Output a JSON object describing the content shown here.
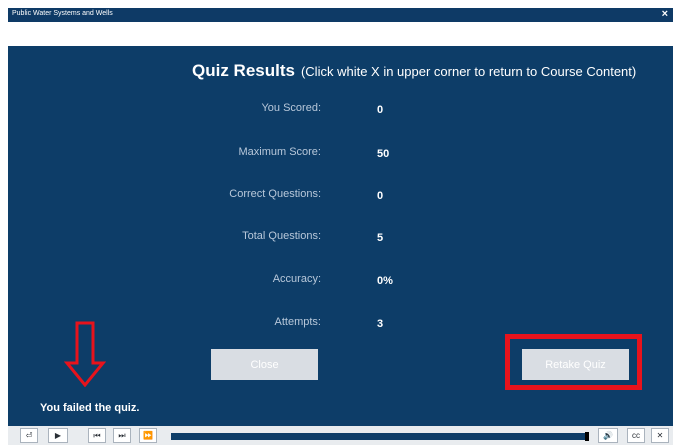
{
  "window": {
    "title": "Public Water Systems and Wells",
    "close_glyph": "×"
  },
  "quiz": {
    "title": "Quiz Results",
    "subtitle": "(Click white X in upper corner to return to Course Content)",
    "rows": [
      {
        "label": "You Scored:",
        "value": "0"
      },
      {
        "label": "Maximum Score:",
        "value": "50"
      },
      {
        "label": "Correct Questions:",
        "value": "0"
      },
      {
        "label": "Total Questions:",
        "value": "5"
      },
      {
        "label": "Accuracy:",
        "value": "0%"
      },
      {
        "label": "Attempts:",
        "value": "3"
      }
    ],
    "close_label": "Close",
    "retake_label": "Retake Quiz",
    "fail_message": "You failed the quiz."
  },
  "annotation": {
    "color": "#e8131c",
    "arrow_icon": "down-arrow-icon",
    "highlight": "retake-quiz-button"
  },
  "player": {
    "buttons": {
      "toc": "⏎",
      "play": "▶",
      "prev": "⏮",
      "next": "⏭",
      "fast_forward": "⏩",
      "volume": "🔊",
      "cc": "cc",
      "exit": "✕"
    },
    "progress_fraction": 1.0
  },
  "colors": {
    "slide_bg": "#0d3d68",
    "titlebar_bg": "#0e3a66",
    "button_bg": "#d9dde3"
  }
}
